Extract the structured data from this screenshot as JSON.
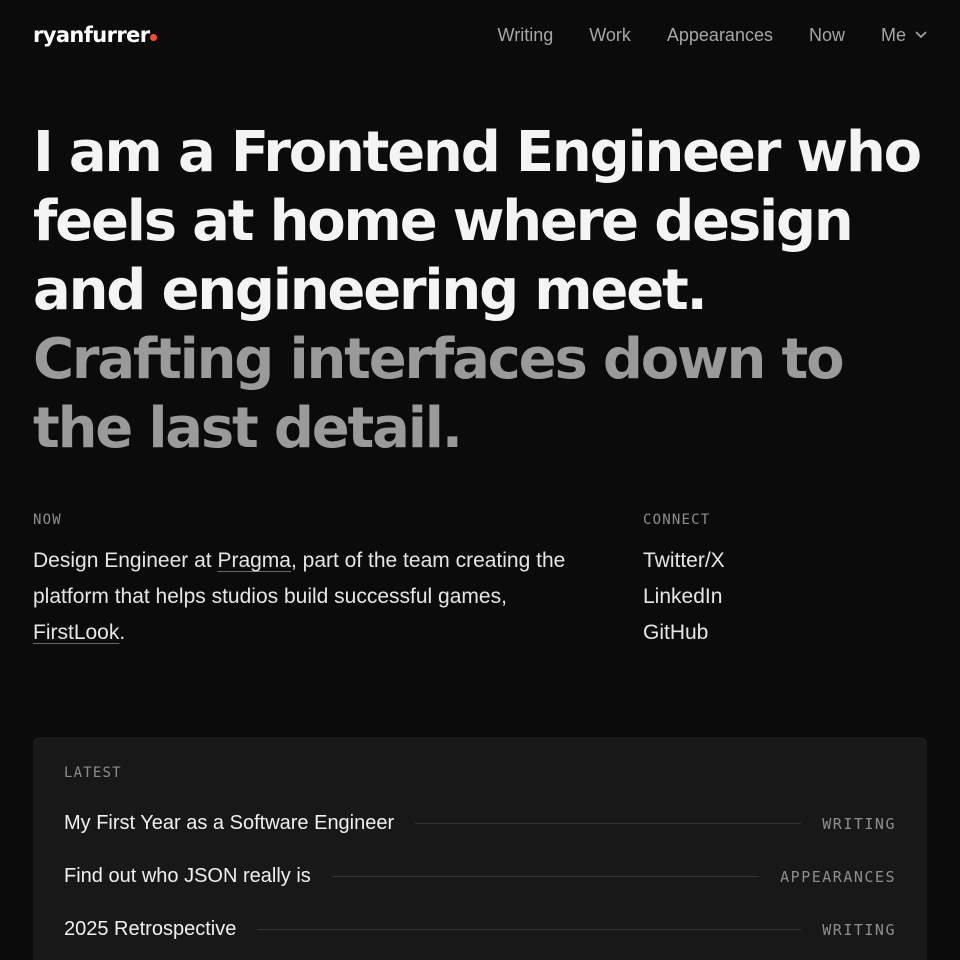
{
  "brand": {
    "logo_text": "ryanfurrer",
    "accent_color": "#ff4d2e"
  },
  "nav": {
    "items": [
      {
        "label": "Writing"
      },
      {
        "label": "Work"
      },
      {
        "label": "Appearances"
      },
      {
        "label": "Now"
      },
      {
        "label": "Me",
        "icon": "chevron-down-icon"
      }
    ]
  },
  "hero": {
    "primary": "I am a Frontend Engineer who feels at home where design and engineering meet.",
    "secondary": "Crafting interfaces down to the last detail."
  },
  "now": {
    "label": "NOW",
    "text_1": "Design Engineer at ",
    "link_1": "Pragma",
    "text_2": ", part of the team creating the platform that helps studios build successful games, ",
    "link_2": "FirstLook",
    "text_3": "."
  },
  "connect": {
    "label": "CONNECT",
    "links": [
      {
        "label": "Twitter/X"
      },
      {
        "label": "LinkedIn"
      },
      {
        "label": "GitHub"
      }
    ]
  },
  "latest": {
    "label": "LATEST",
    "items": [
      {
        "title": "My First Year as a Software Engineer",
        "tag": "WRITING"
      },
      {
        "title": "Find out who JSON really is",
        "tag": "APPEARANCES"
      },
      {
        "title": "2025 Retrospective",
        "tag": "WRITING"
      }
    ]
  }
}
